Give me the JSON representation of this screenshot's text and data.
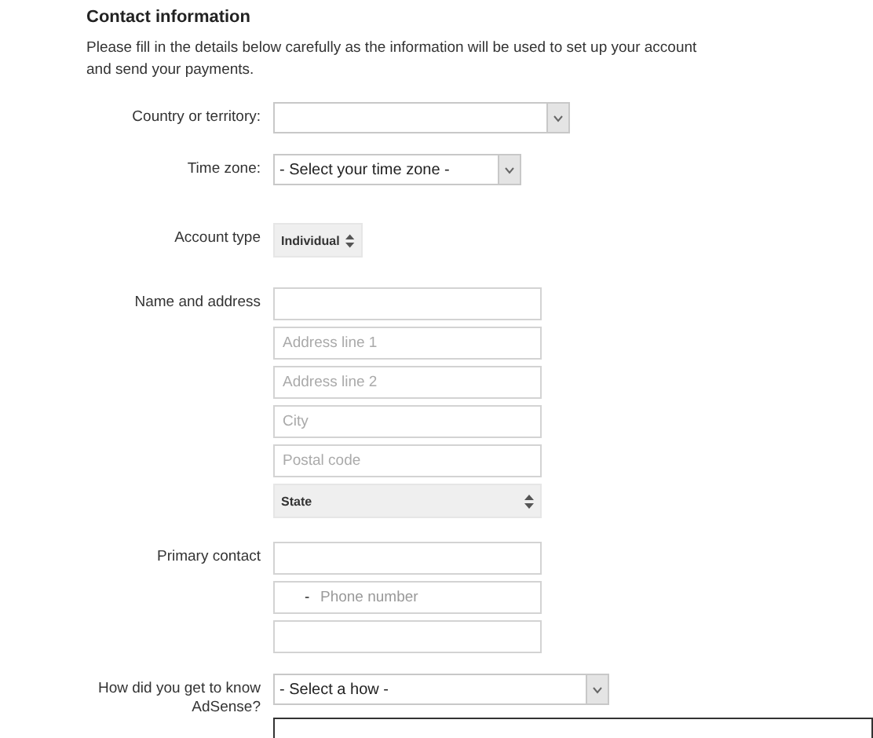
{
  "heading": "Contact information",
  "intro": "Please fill in the details below carefully as the information will be used to set up your account and send your payments.",
  "rows": [
    {
      "label": "Country or territory:",
      "kind": "select",
      "controls": [
        {
          "kind": "select"
        }
      ]
    },
    {
      "label": "Time zone:",
      "kind": "select",
      "controls": [
        {
          "kind": "select",
          "value": "- Select your time zone -"
        }
      ]
    },
    {
      "label": "Account type",
      "kind": "compact",
      "controls": [
        {
          "kind": "spinner",
          "value": "Individual"
        }
      ]
    },
    {
      "label": "Name and address",
      "kind": "group",
      "controls": [
        {
          "kind": "text"
        },
        {
          "kind": "text",
          "placeholder": "Address line 1"
        },
        {
          "kind": "text",
          "placeholder": "Address line 2"
        },
        {
          "kind": "text",
          "placeholder": "City"
        },
        {
          "kind": "text",
          "placeholder": "Postal code"
        },
        {
          "kind": "spinner",
          "value": "State"
        }
      ]
    },
    {
      "label": "Primary contact",
      "kind": "group",
      "controls": [
        {
          "kind": "text"
        },
        {
          "kind": "phone",
          "prefix": "-",
          "placeholder": "Phone number"
        },
        {
          "kind": "text"
        }
      ]
    },
    {
      "label": "How did you get to know AdSense?",
      "kind": "select",
      "controls": [
        {
          "kind": "select",
          "value": "- Select a how -"
        }
      ]
    },
    {
      "kind": "focused",
      "controls": [
        {
          "kind": "focused"
        }
      ]
    }
  ]
}
